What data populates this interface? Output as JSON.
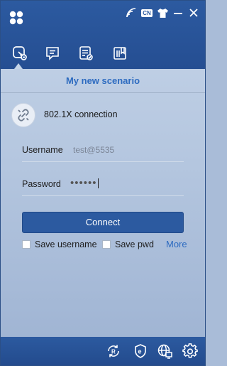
{
  "colors": {
    "brand": "#2c5aa0",
    "accent": "#2d6bc0",
    "panel": "#c5d4e8"
  },
  "titlebar": {
    "lang_badge": "CN",
    "icons": [
      "logo-icon",
      "wifi-signal-icon",
      "language-icon",
      "shirt-skin-icon",
      "minimize-icon",
      "close-icon"
    ]
  },
  "nav": {
    "tabs": [
      {
        "name": "connection-tab",
        "icon": "link-icon",
        "active": true
      },
      {
        "name": "messages-tab",
        "icon": "message-icon",
        "active": false
      },
      {
        "name": "tasks-tab",
        "icon": "checklist-icon",
        "active": false
      },
      {
        "name": "book-tab",
        "icon": "book-icon",
        "active": false
      }
    ]
  },
  "scenario": {
    "title": "My new scenario"
  },
  "connection": {
    "title": "802.1X connection",
    "icon": "link-broken-icon"
  },
  "form": {
    "username_label": "Username",
    "username_value": "test@5535",
    "password_label": "Password",
    "password_value": "••••••"
  },
  "actions": {
    "connect_label": "Connect",
    "save_username_label": "Save username",
    "save_pwd_label": "Save pwd",
    "more_label": "More",
    "save_username_checked": false,
    "save_pwd_checked": false
  },
  "footer": {
    "icons": [
      "refresh-r-icon",
      "shield-e-icon",
      "globe-monitor-icon",
      "settings-gear-icon"
    ]
  }
}
